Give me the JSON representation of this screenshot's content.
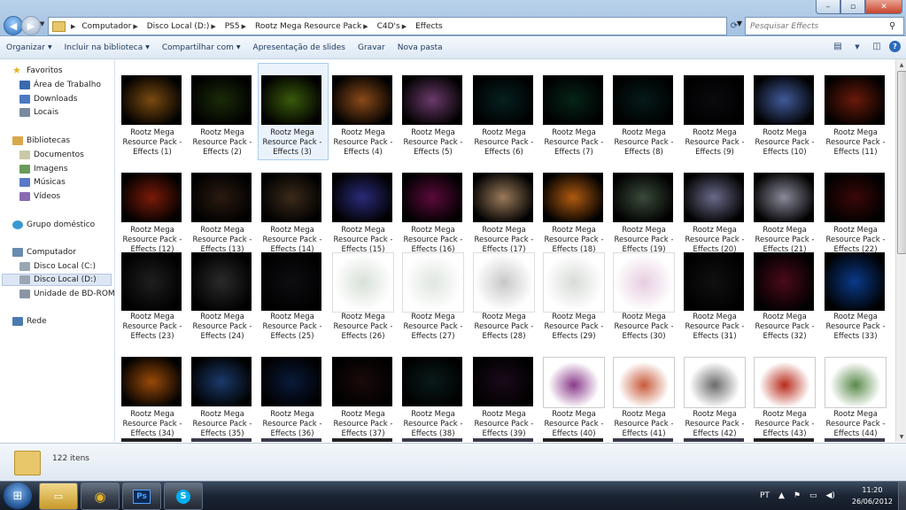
{
  "window": {
    "minimize": "–",
    "maximize": "▫",
    "close": "✕"
  },
  "address_bar": {
    "crumbs": [
      "Computador",
      "Disco Local (D:)",
      "PS5",
      "Rootz Mega Resource Pack",
      "C4D's",
      "Effects"
    ],
    "search_placeholder": "Pesquisar Effects"
  },
  "command_bar": {
    "organize": "Organizar",
    "include_library": "Incluir na biblioteca",
    "share": "Compartilhar com",
    "slideshow": "Apresentação de slides",
    "burn": "Gravar",
    "new_folder": "Nova pasta"
  },
  "nav_pane": {
    "favorites": "Favoritos",
    "favorites_items": [
      "Área de Trabalho",
      "Downloads",
      "Locais"
    ],
    "libraries": "Bibliotecas",
    "libraries_items": [
      "Documentos",
      "Imagens",
      "Músicas",
      "Vídeos"
    ],
    "homegroup": "Grupo doméstico",
    "computer": "Computador",
    "computer_items": [
      "Disco Local (C:)",
      "Disco Local (D:)",
      "Unidade de BD-ROM"
    ],
    "network": "Rede"
  },
  "files": {
    "label_line1": "Rootz Mega",
    "label_line2": "Resource Pack -",
    "names": [
      "Effects (1)",
      "Effects (2)",
      "Effects (3)",
      "Effects (4)",
      "Effects (5)",
      "Effects (6)",
      "Effects (7)",
      "Effects (8)",
      "Effects (9)",
      "Effects (10)",
      "Effects (11)",
      "Effects (12)",
      "Effects (13)",
      "Effects (14)",
      "Effects (15)",
      "Effects (16)",
      "Effects (17)",
      "Effects (18)",
      "Effects (19)",
      "Effects (20)",
      "Effects (21)",
      "Effects (22)",
      "Effects (23)",
      "Effects (24)",
      "Effects (25)",
      "Effects (26)",
      "Effects (27)",
      "Effects (28)",
      "Effects (29)",
      "Effects (30)",
      "Effects (31)",
      "Effects (32)",
      "Effects (33)",
      "Effects (34)",
      "Effects (35)",
      "Effects (36)",
      "Effects (37)",
      "Effects (38)",
      "Effects (39)",
      "Effects (40)",
      "Effects (41)",
      "Effects (42)",
      "Effects (43)",
      "Effects (44)"
    ],
    "selected_index": 2,
    "thumb_colors": [
      "#7a4a10",
      "#1a2a08",
      "#3a5a0a",
      "#8a4a1a",
      "#6a3a6a",
      "#062020",
      "#062418",
      "#061a1a",
      "#0a0a0e",
      "#405a9a",
      "#6a1a0a",
      "#7a1a08",
      "#2a1a10",
      "#3a2a1a",
      "#2a2a7a",
      "#5a0a3a",
      "#9a7a5a",
      "#b05a10",
      "#3a4a3a",
      "#6a6a8a",
      "#8a8a9a",
      "#3a0808",
      "#1e1e1e",
      "#2a2a2a",
      "#0e0e12",
      "#d8e0d8",
      "#e0e6e0",
      "#c8c8c8",
      "#d8dcd8",
      "#e6cde0",
      "#101010",
      "#4a0a1a",
      "#0a3a8a",
      "#9a4a08",
      "#1a3a6a",
      "#0a1a3a",
      "#1a0a0a",
      "#0a1a1a",
      "#1a0a1a",
      "#8a3a8a",
      "#c85a3a",
      "#6a6a6a",
      "#b82a1a",
      "#5a8a4a"
    ]
  },
  "details": {
    "count": "122 itens"
  },
  "taskbar": {
    "start": "⊞",
    "apps": [
      "Windows Explorer",
      "Google Chrome",
      "Photoshop",
      "Skype"
    ],
    "apps_glyph": [
      "▭",
      "◉",
      "Ps",
      "S"
    ],
    "language": "PT",
    "time": "11:20",
    "date": "26/06/2012"
  }
}
